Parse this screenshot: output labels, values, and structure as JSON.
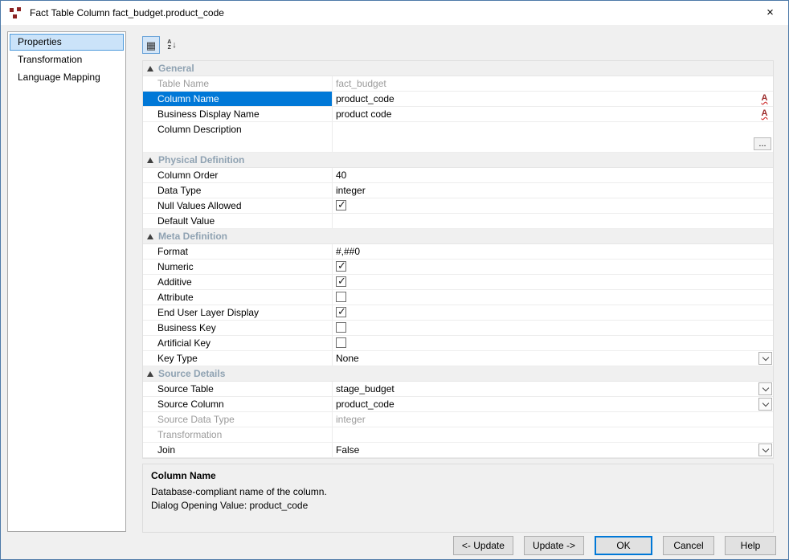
{
  "window": {
    "title": "Fact Table Column fact_budget.product_code"
  },
  "sidebar": {
    "items": [
      {
        "label": "Properties",
        "selected": true
      },
      {
        "label": "Transformation",
        "selected": false
      },
      {
        "label": "Language Mapping",
        "selected": false
      }
    ]
  },
  "icons": {
    "check": "✓",
    "naming_letter": "A",
    "ellipsis": "...",
    "close": "×",
    "categorized": "▦",
    "sort_letters": [
      "A",
      "Z"
    ],
    "sort_arrow": "↓"
  },
  "property_grid": {
    "sections": [
      {
        "title": "General",
        "rows": [
          {
            "label": "Table Name",
            "value": "fact_budget",
            "type": "text",
            "disabled": true
          },
          {
            "label": "Column Name",
            "value": "product_code",
            "type": "text",
            "selected": true,
            "control": "naming"
          },
          {
            "label": "Business Display Name",
            "value": "product code",
            "type": "text",
            "control": "naming"
          },
          {
            "label": "Column Description",
            "value": "",
            "type": "text",
            "tall": true,
            "control": "ellipsis"
          }
        ]
      },
      {
        "title": "Physical Definition",
        "rows": [
          {
            "label": "Column Order",
            "value": "40",
            "type": "text"
          },
          {
            "label": "Data Type",
            "value": "integer",
            "type": "text"
          },
          {
            "label": "Null Values Allowed",
            "type": "checkbox",
            "checked": true
          },
          {
            "label": "Default Value",
            "value": "",
            "type": "text"
          }
        ]
      },
      {
        "title": "Meta Definition",
        "rows": [
          {
            "label": "Format",
            "value": "#,##0",
            "type": "text"
          },
          {
            "label": "Numeric",
            "type": "checkbox",
            "checked": true
          },
          {
            "label": "Additive",
            "type": "checkbox",
            "checked": true
          },
          {
            "label": "Attribute",
            "type": "checkbox",
            "checked": false
          },
          {
            "label": "End User Layer Display",
            "type": "checkbox",
            "checked": true
          },
          {
            "label": "Business Key",
            "type": "checkbox",
            "checked": false
          },
          {
            "label": "Artificial Key",
            "type": "checkbox",
            "checked": false
          },
          {
            "label": "Key Type",
            "value": "None",
            "type": "text",
            "control": "dropdown"
          }
        ]
      },
      {
        "title": "Source Details",
        "rows": [
          {
            "label": "Source Table",
            "value": "stage_budget",
            "type": "text",
            "control": "dropdown"
          },
          {
            "label": "Source Column",
            "value": "product_code",
            "type": "text",
            "control": "dropdown"
          },
          {
            "label": "Source Data Type",
            "value": "integer",
            "type": "text",
            "disabled": true
          },
          {
            "label": "Transformation",
            "value": "",
            "type": "text",
            "disabled": true
          },
          {
            "label": "Join",
            "value": "False",
            "type": "text",
            "control": "dropdown"
          }
        ]
      }
    ]
  },
  "description_panel": {
    "title": "Column Name",
    "line1": "Database-compliant name of the column.",
    "line2": "Dialog Opening Value: product_code"
  },
  "footer": {
    "buttons": [
      {
        "label": "<- Update",
        "name": "update-left-button"
      },
      {
        "label": "Update ->",
        "name": "update-right-button"
      },
      {
        "label": "OK",
        "name": "ok-button",
        "default": true
      },
      {
        "label": "Cancel",
        "name": "cancel-button"
      },
      {
        "label": "Help",
        "name": "help-button"
      }
    ]
  }
}
